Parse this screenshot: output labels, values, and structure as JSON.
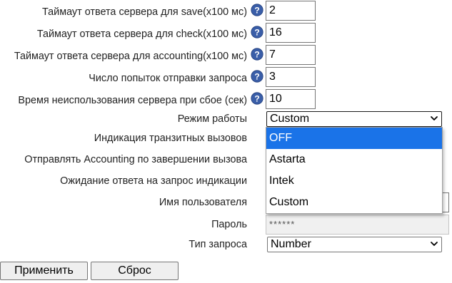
{
  "form": {
    "save_timeout": {
      "label": "Таймаут ответа сервера для save(x100 мс)",
      "value": "2"
    },
    "check_timeout": {
      "label": "Таймаут ответа сервера для check(x100 мс)",
      "value": "16"
    },
    "accounting_timeout": {
      "label": "Таймаут ответа сервера для accounting(x100 мс)",
      "value": "7"
    },
    "retry_count": {
      "label": "Число попыток отправки запроса",
      "value": "3"
    },
    "server_idle_time": {
      "label": "Время неиспользования сервера при сбое (сек)",
      "value": "10"
    },
    "mode": {
      "label": "Режим работы",
      "value": "Custom"
    },
    "transit_calls": {
      "label": "Индикация транзитных вызовов"
    },
    "accounting_on_end": {
      "label": "Отправлять Accounting по завершении вызова"
    },
    "indication_wait": {
      "label": "Ожидание ответа на запрос индикации"
    },
    "username": {
      "label": "Имя пользователя",
      "value": ""
    },
    "password": {
      "label": "Пароль",
      "value": "******"
    },
    "request_type": {
      "label": "Тип запроса",
      "value": "Number"
    }
  },
  "dropdown": {
    "options": [
      "OFF",
      "Astarta",
      "Intek",
      "Custom"
    ],
    "highlighted": "OFF"
  },
  "buttons": {
    "apply": "Применить",
    "reset": "Сброс"
  },
  "icons": {
    "help": "help-icon",
    "chevron": "chevron-down-icon"
  },
  "colors": {
    "highlight": "#1a73e8",
    "help_icon": "#3a5ea8"
  }
}
